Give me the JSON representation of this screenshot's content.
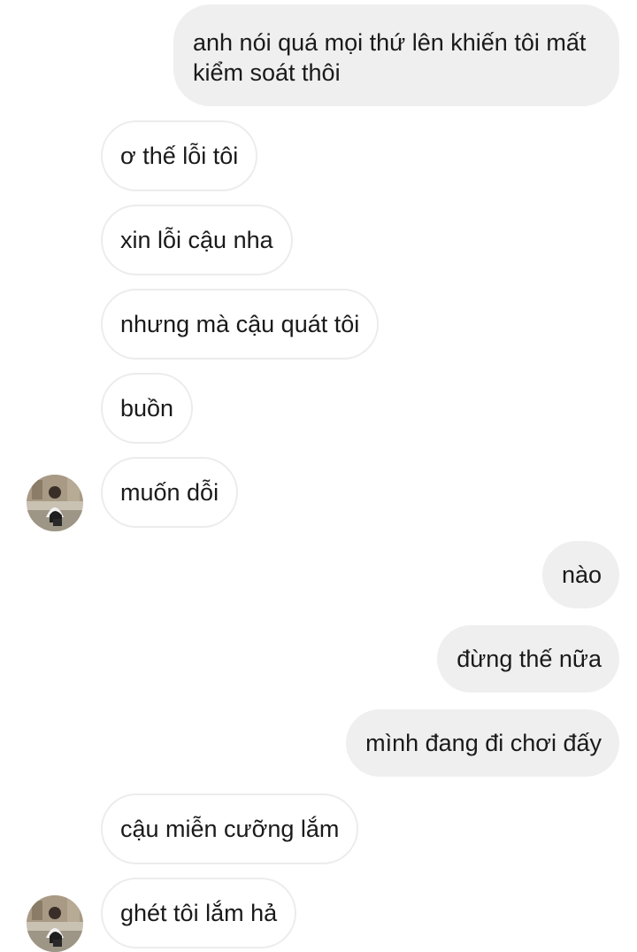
{
  "messages": [
    {
      "side": "sent",
      "text": "anh nói quá mọi thứ lên khiến tôi mất kiểm soát thôi"
    },
    {
      "side": "received",
      "text": "ơ thế lỗi tôi"
    },
    {
      "side": "received",
      "text": "xin lỗi cậu nha"
    },
    {
      "side": "received",
      "text": "nhưng mà cậu quát tôi"
    },
    {
      "side": "received",
      "text": "buồn"
    },
    {
      "side": "received",
      "text": "muốn dỗi",
      "avatar": true
    },
    {
      "side": "sent",
      "text": "nào"
    },
    {
      "side": "sent",
      "text": "đừng thế nữa"
    },
    {
      "side": "sent",
      "text": "mình đang đi chơi đấy"
    },
    {
      "side": "received",
      "text": "cậu miễn cưỡng lắm"
    },
    {
      "side": "received",
      "text": "ghét tôi lắm hả",
      "avatar": true
    }
  ],
  "avatar_icon": "contact-photo",
  "colors": {
    "sent_bubble": "#efefef",
    "received_border": "#ececec",
    "text": "#1a1a1a"
  }
}
